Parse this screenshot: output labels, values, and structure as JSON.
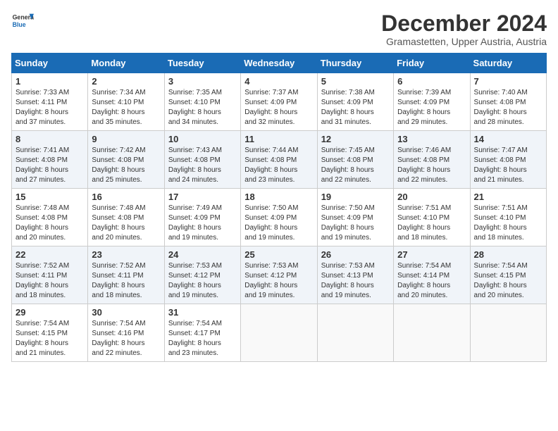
{
  "logo": {
    "line1": "General",
    "line2": "Blue"
  },
  "title": "December 2024",
  "subtitle": "Gramastetten, Upper Austria, Austria",
  "header_days": [
    "Sunday",
    "Monday",
    "Tuesday",
    "Wednesday",
    "Thursday",
    "Friday",
    "Saturday"
  ],
  "weeks": [
    [
      {
        "day": "1",
        "info": "Sunrise: 7:33 AM\nSunset: 4:11 PM\nDaylight: 8 hours\nand 37 minutes."
      },
      {
        "day": "2",
        "info": "Sunrise: 7:34 AM\nSunset: 4:10 PM\nDaylight: 8 hours\nand 35 minutes."
      },
      {
        "day": "3",
        "info": "Sunrise: 7:35 AM\nSunset: 4:10 PM\nDaylight: 8 hours\nand 34 minutes."
      },
      {
        "day": "4",
        "info": "Sunrise: 7:37 AM\nSunset: 4:09 PM\nDaylight: 8 hours\nand 32 minutes."
      },
      {
        "day": "5",
        "info": "Sunrise: 7:38 AM\nSunset: 4:09 PM\nDaylight: 8 hours\nand 31 minutes."
      },
      {
        "day": "6",
        "info": "Sunrise: 7:39 AM\nSunset: 4:09 PM\nDaylight: 8 hours\nand 29 minutes."
      },
      {
        "day": "7",
        "info": "Sunrise: 7:40 AM\nSunset: 4:08 PM\nDaylight: 8 hours\nand 28 minutes."
      }
    ],
    [
      {
        "day": "8",
        "info": "Sunrise: 7:41 AM\nSunset: 4:08 PM\nDaylight: 8 hours\nand 27 minutes."
      },
      {
        "day": "9",
        "info": "Sunrise: 7:42 AM\nSunset: 4:08 PM\nDaylight: 8 hours\nand 25 minutes."
      },
      {
        "day": "10",
        "info": "Sunrise: 7:43 AM\nSunset: 4:08 PM\nDaylight: 8 hours\nand 24 minutes."
      },
      {
        "day": "11",
        "info": "Sunrise: 7:44 AM\nSunset: 4:08 PM\nDaylight: 8 hours\nand 23 minutes."
      },
      {
        "day": "12",
        "info": "Sunrise: 7:45 AM\nSunset: 4:08 PM\nDaylight: 8 hours\nand 22 minutes."
      },
      {
        "day": "13",
        "info": "Sunrise: 7:46 AM\nSunset: 4:08 PM\nDaylight: 8 hours\nand 22 minutes."
      },
      {
        "day": "14",
        "info": "Sunrise: 7:47 AM\nSunset: 4:08 PM\nDaylight: 8 hours\nand 21 minutes."
      }
    ],
    [
      {
        "day": "15",
        "info": "Sunrise: 7:48 AM\nSunset: 4:08 PM\nDaylight: 8 hours\nand 20 minutes."
      },
      {
        "day": "16",
        "info": "Sunrise: 7:48 AM\nSunset: 4:08 PM\nDaylight: 8 hours\nand 20 minutes."
      },
      {
        "day": "17",
        "info": "Sunrise: 7:49 AM\nSunset: 4:09 PM\nDaylight: 8 hours\nand 19 minutes."
      },
      {
        "day": "18",
        "info": "Sunrise: 7:50 AM\nSunset: 4:09 PM\nDaylight: 8 hours\nand 19 minutes."
      },
      {
        "day": "19",
        "info": "Sunrise: 7:50 AM\nSunset: 4:09 PM\nDaylight: 8 hours\nand 19 minutes."
      },
      {
        "day": "20",
        "info": "Sunrise: 7:51 AM\nSunset: 4:10 PM\nDaylight: 8 hours\nand 18 minutes."
      },
      {
        "day": "21",
        "info": "Sunrise: 7:51 AM\nSunset: 4:10 PM\nDaylight: 8 hours\nand 18 minutes."
      }
    ],
    [
      {
        "day": "22",
        "info": "Sunrise: 7:52 AM\nSunset: 4:11 PM\nDaylight: 8 hours\nand 18 minutes."
      },
      {
        "day": "23",
        "info": "Sunrise: 7:52 AM\nSunset: 4:11 PM\nDaylight: 8 hours\nand 18 minutes."
      },
      {
        "day": "24",
        "info": "Sunrise: 7:53 AM\nSunset: 4:12 PM\nDaylight: 8 hours\nand 19 minutes."
      },
      {
        "day": "25",
        "info": "Sunrise: 7:53 AM\nSunset: 4:12 PM\nDaylight: 8 hours\nand 19 minutes."
      },
      {
        "day": "26",
        "info": "Sunrise: 7:53 AM\nSunset: 4:13 PM\nDaylight: 8 hours\nand 19 minutes."
      },
      {
        "day": "27",
        "info": "Sunrise: 7:54 AM\nSunset: 4:14 PM\nDaylight: 8 hours\nand 20 minutes."
      },
      {
        "day": "28",
        "info": "Sunrise: 7:54 AM\nSunset: 4:15 PM\nDaylight: 8 hours\nand 20 minutes."
      }
    ],
    [
      {
        "day": "29",
        "info": "Sunrise: 7:54 AM\nSunset: 4:15 PM\nDaylight: 8 hours\nand 21 minutes."
      },
      {
        "day": "30",
        "info": "Sunrise: 7:54 AM\nSunset: 4:16 PM\nDaylight: 8 hours\nand 22 minutes."
      },
      {
        "day": "31",
        "info": "Sunrise: 7:54 AM\nSunset: 4:17 PM\nDaylight: 8 hours\nand 23 minutes."
      },
      {
        "day": "",
        "info": ""
      },
      {
        "day": "",
        "info": ""
      },
      {
        "day": "",
        "info": ""
      },
      {
        "day": "",
        "info": ""
      }
    ]
  ]
}
